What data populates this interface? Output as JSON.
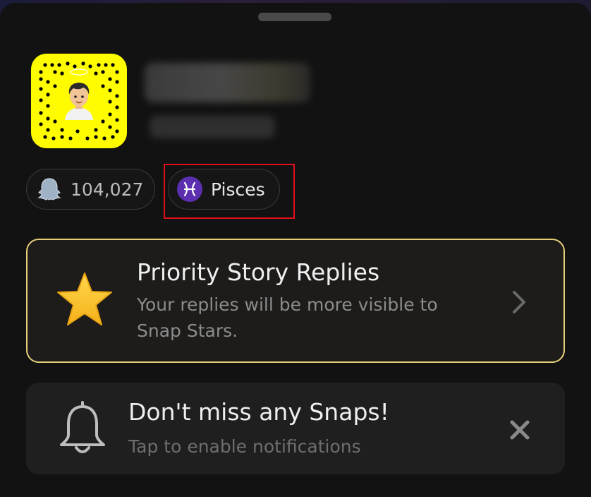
{
  "profile": {
    "snapscore": "104,027",
    "zodiac": "Pisces",
    "zodiac_symbol": "♓"
  },
  "priority_card": {
    "title": "Priority Story Replies",
    "subtitle": "Your replies will be more visible to Snap Stars."
  },
  "notify_card": {
    "title": "Don't miss any Snaps!",
    "subtitle": "Tap to enable notifications"
  },
  "colors": {
    "background": "#121212",
    "snapcode_yellow": "#fffc00",
    "zodiac_purple": "#5b2fb0",
    "priority_border": "#e6cf7a",
    "highlight_red": "#e0101a"
  },
  "icons": {
    "ghost": "ghost-icon",
    "zodiac": "pisces-icon",
    "star": "star-icon",
    "chevron": "chevron-right-icon",
    "bell": "bell-icon",
    "close": "close-icon"
  }
}
